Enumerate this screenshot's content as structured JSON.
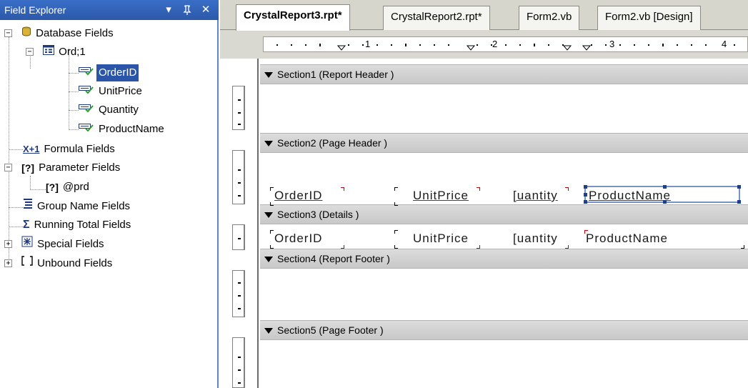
{
  "field_explorer": {
    "title": "Field Explorer",
    "buttons": {
      "dropdown": "▾",
      "pin": "ᵽ",
      "close": "✕"
    },
    "tree": [
      {
        "label": "Database Fields",
        "icon": "database-icon",
        "expander": "−"
      },
      {
        "label": "Ord;1",
        "icon": "table-icon",
        "expander": "−"
      },
      {
        "label": "OrderID",
        "icon": "field-icon",
        "selected": true
      },
      {
        "label": "UnitPrice",
        "icon": "field-icon"
      },
      {
        "label": "Quantity",
        "icon": "field-icon"
      },
      {
        "label": "ProductName",
        "icon": "field-icon"
      },
      {
        "label": "Formula Fields",
        "icon": "formula-icon",
        "icon_text": "X+1"
      },
      {
        "label": "Parameter Fields",
        "icon": "parameter-icon",
        "icon_text": "[?]",
        "expander": "−"
      },
      {
        "label": "@prd",
        "icon": "parameter-item-icon",
        "icon_text": "[?]"
      },
      {
        "label": "Group Name Fields",
        "icon": "group-name-icon"
      },
      {
        "label": "Running Total Fields",
        "icon": "running-total-icon",
        "icon_text": "Σ"
      },
      {
        "label": "Special Fields",
        "icon": "special-fields-icon",
        "expander": "+"
      },
      {
        "label": "Unbound Fields",
        "icon": "unbound-fields-icon",
        "expander": "+"
      }
    ]
  },
  "tabs": [
    {
      "label": "CrystalReport3.rpt*",
      "active": true
    },
    {
      "label": "CrystalReport2.rpt*"
    },
    {
      "label": "Form2.vb"
    },
    {
      "label": "Form2.vb [Design]"
    }
  ],
  "ruler": {
    "numbers": [
      "1",
      "2",
      "3",
      "4"
    ]
  },
  "sections": [
    {
      "label": "Section1 (Report Header )"
    },
    {
      "label": "Section2 (Page Header )"
    },
    {
      "label": "Section3 (Details )"
    },
    {
      "label": "Section4 (Report Footer )"
    },
    {
      "label": "Section5 (Page Footer )"
    }
  ],
  "page_header_fields": [
    {
      "text": "OrderID"
    },
    {
      "text": "UnitPrice"
    },
    {
      "text": "[uantity"
    },
    {
      "text": "ProductName",
      "selected": true
    }
  ],
  "detail_fields": [
    {
      "text": "OrderID"
    },
    {
      "text": "UnitPrice"
    },
    {
      "text": "[uantity"
    },
    {
      "text": "ProductName"
    }
  ],
  "colors": {
    "title_bar": "#2c58a8",
    "selection": "#2a55a8",
    "section_bar": "#d0d0d0",
    "field_corner_marker": "#cc0000"
  }
}
